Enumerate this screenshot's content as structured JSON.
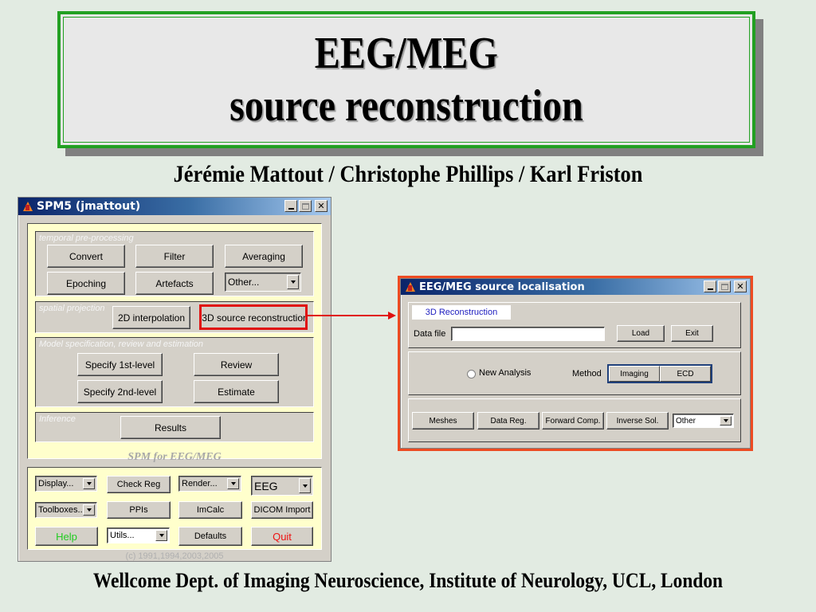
{
  "slide": {
    "title_line1": "EEG/MEG",
    "title_line2": "source reconstruction",
    "authors": "Jérémie Mattout / Christophe Phillips / Karl Friston",
    "affiliation": "Wellcome Dept. of Imaging Neuroscience, Institute of Neurology, UCL, London"
  },
  "spm_window": {
    "title": "SPM5 (jmattout)",
    "window_buttons": {
      "minimize": "_",
      "maximize": "□",
      "close": "✕"
    },
    "temporal": {
      "label": "temporal pre-processing",
      "buttons": [
        "Convert",
        "Filter",
        "Averaging",
        "Epoching",
        "Artefacts"
      ],
      "other_dropdown": "Other..."
    },
    "spatial": {
      "label": "spatial projection",
      "buttons": [
        "2D interpolation",
        "3D source reconstruction"
      ]
    },
    "model": {
      "label": "Model specification, review and estimation",
      "buttons": [
        "Specify 1st-level",
        "Review",
        "Specify 2nd-level",
        "Estimate"
      ]
    },
    "inference": {
      "label": "Inference",
      "buttons": [
        "Results"
      ]
    },
    "caption": "SPM for EEG/MEG",
    "utilities": {
      "display_dropdown": "Display...",
      "check_reg": "Check Reg",
      "render_dropdown": "Render...",
      "modality_dropdown": "EEG",
      "toolboxes_dropdown": "Toolboxes...",
      "ppis": "PPIs",
      "imcalc": "ImCalc",
      "dicom_import": "DICOM Import",
      "help": "Help",
      "utils_dropdown": "Utils...",
      "defaults": "Defaults",
      "quit": "Quit"
    },
    "copyright": "(c) 1991,1994,2003,2005"
  },
  "loc_window": {
    "title": "EEG/MEG source localisation",
    "window_buttons": {
      "minimize": "_",
      "maximize": "□",
      "close": "✕"
    },
    "tab": "3D Reconstruction",
    "data_file_label": "Data file",
    "data_file_value": "",
    "load": "Load",
    "exit": "Exit",
    "new_analysis": "New Analysis",
    "method_label": "Method",
    "method_options": [
      "Imaging",
      "ECD"
    ],
    "steps": [
      "Meshes",
      "Data Reg.",
      "Forward Comp.",
      "Inverse Sol."
    ],
    "other_dropdown": "Other"
  },
  "colors": {
    "slide_bg": "#e2ebe2",
    "title_border": "#22a022",
    "highlight_red": "#e01010",
    "frame_orange": "#ee4b22",
    "help_green": "#22cc22",
    "quit_red": "#ee1111",
    "tab_blue": "#2020c0"
  }
}
